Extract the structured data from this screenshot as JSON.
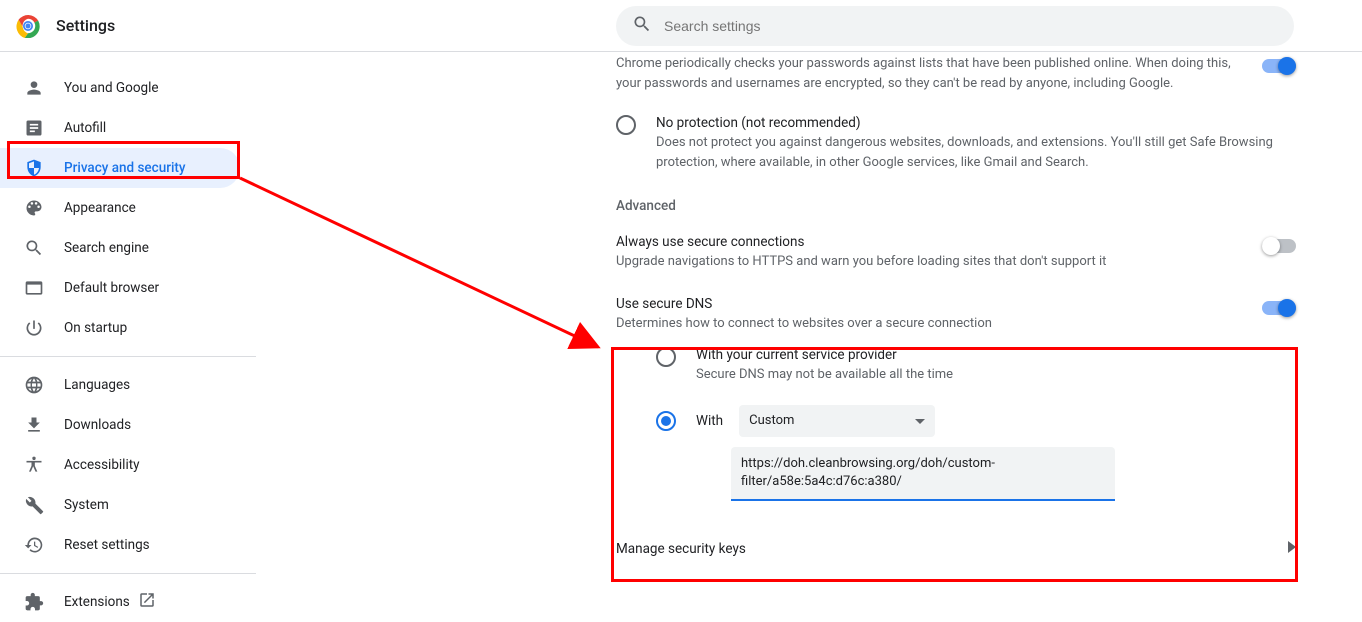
{
  "header": {
    "title": "Settings",
    "search_placeholder": "Search settings"
  },
  "sidebar": {
    "items": [
      {
        "label": "You and Google"
      },
      {
        "label": "Autofill"
      },
      {
        "label": "Privacy and security"
      },
      {
        "label": "Appearance"
      },
      {
        "label": "Search engine"
      },
      {
        "label": "Default browser"
      },
      {
        "label": "On startup"
      }
    ],
    "items2": [
      {
        "label": "Languages"
      },
      {
        "label": "Downloads"
      },
      {
        "label": "Accessibility"
      },
      {
        "label": "System"
      },
      {
        "label": "Reset settings"
      }
    ],
    "extensions_label": "Extensions"
  },
  "content": {
    "pw_check_desc": "Chrome periodically checks your passwords against lists that have been published online. When doing this, your passwords and usernames are encrypted, so they can't be read by anyone, including Google.",
    "no_protection_title": "No protection (not recommended)",
    "no_protection_desc": "Does not protect you against dangerous websites, downloads, and extensions. You'll still get Safe Browsing protection, where available, in other Google services, like Gmail and Search.",
    "advanced_label": "Advanced",
    "secure_conn_title": "Always use secure connections",
    "secure_conn_desc": "Upgrade navigations to HTTPS and warn you before loading sites that don't support it",
    "secure_dns_title": "Use secure DNS",
    "secure_dns_desc": "Determines how to connect to websites over a secure connection",
    "dns_current_title": "With your current service provider",
    "dns_current_desc": "Secure DNS may not be available all the time",
    "dns_with_label": "With",
    "dns_provider_select": "Custom",
    "dns_custom_url": "https://doh.cleanbrowsing.org/doh/custom-filter/a58e:5a4c:d76c:a380/",
    "manage_keys_label": "Manage security keys"
  }
}
